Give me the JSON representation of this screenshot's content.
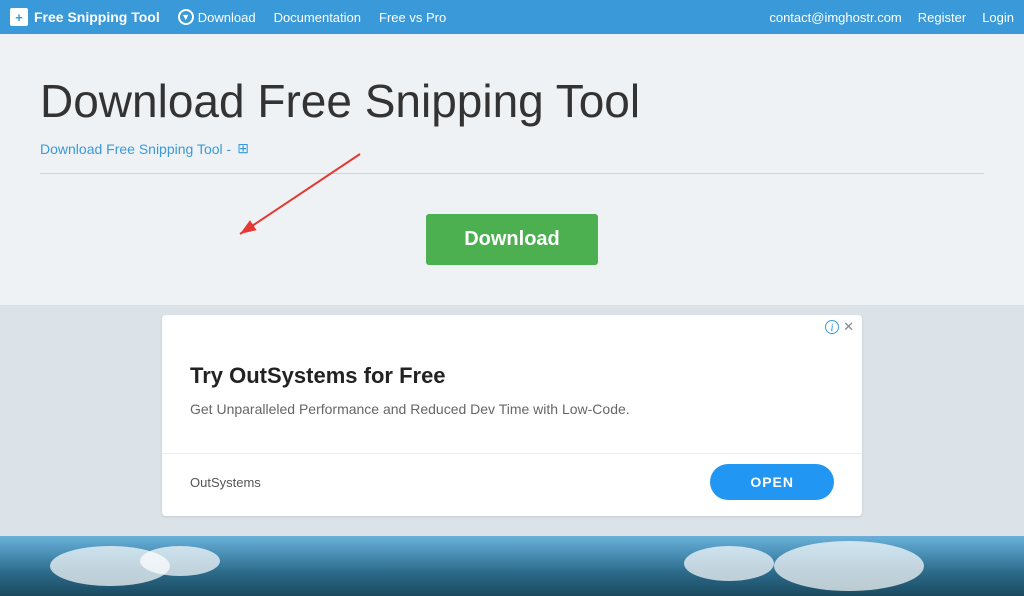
{
  "navbar": {
    "brand_label": "Free Snipping Tool",
    "download_label": "Download",
    "documentation_label": "Documentation",
    "free_vs_pro_label": "Free vs Pro",
    "contact_label": "contact@imghostr.com",
    "register_label": "Register",
    "login_label": "Login"
  },
  "main": {
    "page_title": "Download Free Snipping Tool",
    "subtitle_link": "Download Free Snipping Tool -",
    "download_button_label": "Download"
  },
  "ad": {
    "title": "Try OutSystems for Free",
    "description": "Get Unparalleled Performance and Reduced Dev Time with Low-Code.",
    "brand_name": "OutSystems",
    "open_button_label": "OPEN"
  },
  "icons": {
    "brand_plus": "+",
    "download_circle": "⬇",
    "windows": "⊞",
    "info": "i",
    "close": "✕"
  }
}
